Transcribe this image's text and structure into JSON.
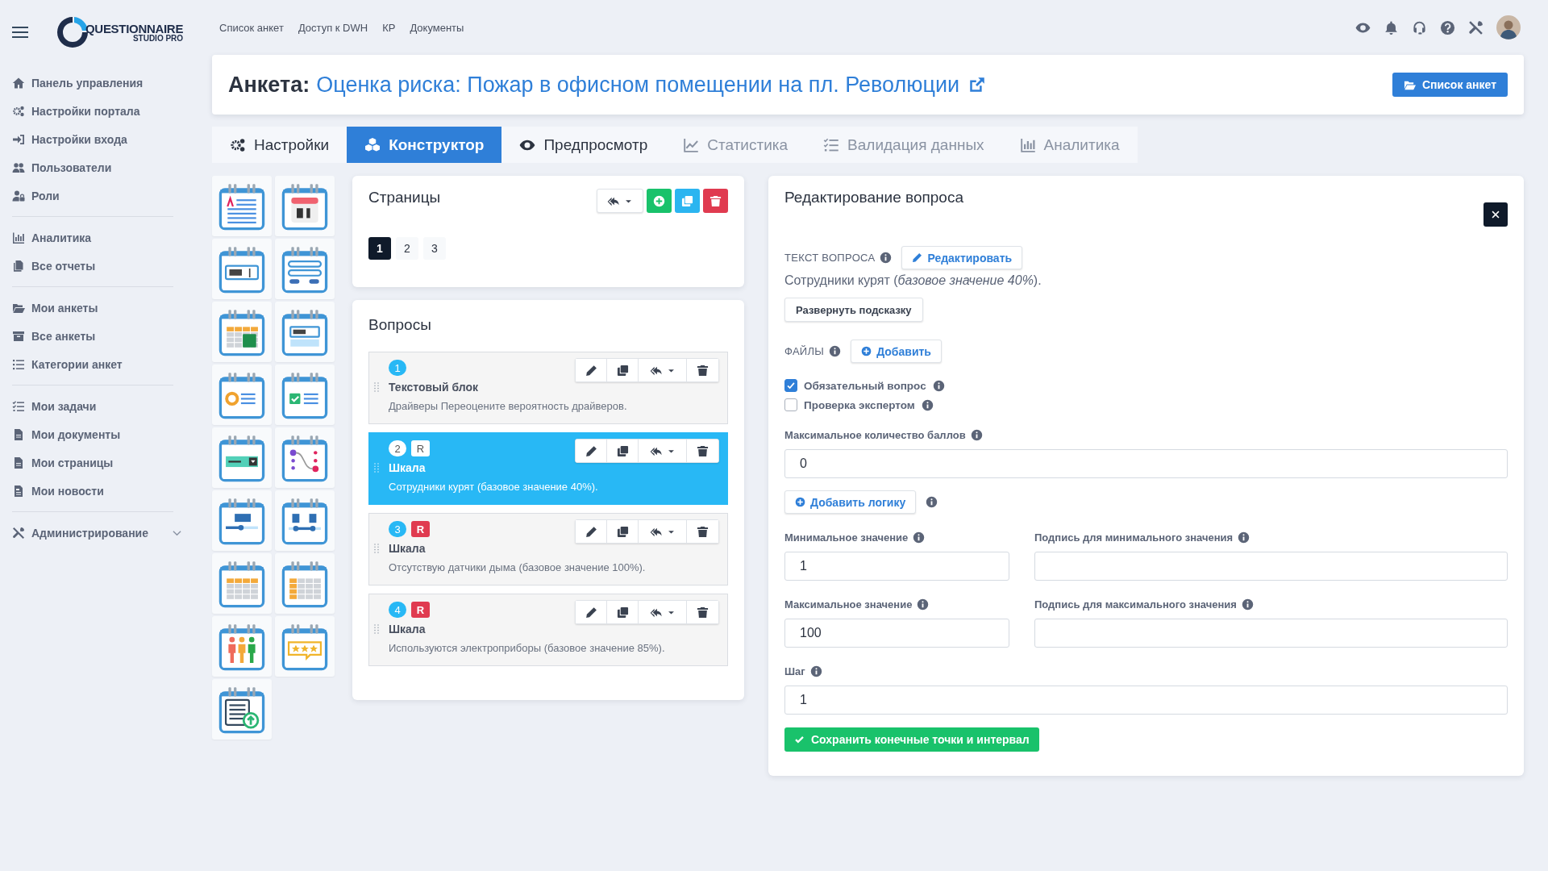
{
  "logo": {
    "line1": "QUESTIONNAIRE",
    "line2": "STUDIO PRO"
  },
  "sidebar": {
    "groups": [
      {
        "items": [
          {
            "label": "Панель управления"
          },
          {
            "label": "Настройки портала"
          },
          {
            "label": "Настройки входа"
          },
          {
            "label": "Пользователи"
          },
          {
            "label": "Роли"
          }
        ]
      },
      {
        "items": [
          {
            "label": "Аналитика"
          },
          {
            "label": "Все отчеты"
          }
        ]
      },
      {
        "items": [
          {
            "label": "Мои анкеты"
          },
          {
            "label": "Все анкеты"
          },
          {
            "label": "Категории анкет"
          }
        ]
      },
      {
        "items": [
          {
            "label": "Мои задачи"
          },
          {
            "label": "Мои документы"
          },
          {
            "label": "Мои страницы"
          },
          {
            "label": "Мои новости"
          }
        ]
      }
    ],
    "footer_item": {
      "label": "Администрирование"
    }
  },
  "top_nav": [
    "Список анкет",
    "Доступ к DWH",
    "КР",
    "Документы"
  ],
  "header": {
    "prefix": "Анкета:",
    "title": "Оценка риска: Пожар в офисном помещении на пл. Революции",
    "button": "Список анкет"
  },
  "tabs": [
    {
      "label": "Настройки",
      "selected": false,
      "disabled": false
    },
    {
      "label": "Конструктор",
      "selected": true,
      "disabled": false
    },
    {
      "label": "Предпросмотр",
      "selected": false,
      "disabled": false
    },
    {
      "label": "Статистика",
      "selected": false,
      "disabled": true
    },
    {
      "label": "Валидация данных",
      "selected": false,
      "disabled": true
    },
    {
      "label": "Аналитика",
      "selected": false,
      "disabled": true
    }
  ],
  "palette": [
    {
      "kind": "text_block"
    },
    {
      "kind": "date"
    },
    {
      "kind": "text_input"
    },
    {
      "kind": "form"
    },
    {
      "kind": "spreadsheet"
    },
    {
      "kind": "answer_input"
    },
    {
      "kind": "radio"
    },
    {
      "kind": "checkbox"
    },
    {
      "kind": "dropdown"
    },
    {
      "kind": "matching"
    },
    {
      "kind": "slider"
    },
    {
      "kind": "range"
    },
    {
      "kind": "table"
    },
    {
      "kind": "table_column"
    },
    {
      "kind": "people"
    },
    {
      "kind": "rating"
    },
    {
      "kind": "upload"
    }
  ],
  "pages_panel": {
    "title": "Страницы",
    "pages": [
      {
        "label": "1",
        "selected": true
      },
      {
        "label": "2",
        "selected": false
      },
      {
        "label": "3",
        "selected": false
      }
    ]
  },
  "questions_panel": {
    "title": "Вопросы",
    "questions": [
      {
        "number": "1",
        "title": "Текстовый блок",
        "text": "Драйверы Переоцените вероятность драйверов.",
        "selected": false
      },
      {
        "number": "2",
        "badge": "R",
        "title": "Шкала",
        "text": "Сотрудники курят (базовое значение 40%).",
        "selected": true
      },
      {
        "number": "3",
        "badge": "R",
        "title": "Шкала",
        "text": "Отсутствую датчики дыма (базовое значение 100%).",
        "selected": false
      },
      {
        "number": "4",
        "badge": "R",
        "title": "Шкала",
        "text": "Используются электроприборы (базовое значение 85%).",
        "selected": false
      }
    ]
  },
  "editor": {
    "title": "Редактирование вопроса",
    "text_label": "ТЕКСТ ВОПРОСА",
    "edit_button": "Редактировать",
    "question_text": "Сотрудники курят (*базовое значение 40%*).",
    "hint_button": "Развернуть подсказку",
    "files_label": "ФАЙЛЫ",
    "add_button": "Добавить",
    "checkboxes": [
      {
        "label": "Обязательный вопрос",
        "checked": true
      },
      {
        "label": "Проверка экспертом",
        "checked": false
      }
    ],
    "max_score": {
      "label": "Максимальное количество баллов",
      "value": "0"
    },
    "logic_button": "Добавить логику",
    "min": {
      "label": "Минимальное значение",
      "value": "1"
    },
    "min_caption": {
      "label": "Подпись для минимального значения"
    },
    "max": {
      "label": "Максимальное значение",
      "value": "100"
    },
    "max_caption": {
      "label": "Подпись для максимального значения"
    },
    "step": {
      "label": "Шаг",
      "value": "1"
    },
    "save_button": "Сохранить конечные точки и интервал"
  }
}
